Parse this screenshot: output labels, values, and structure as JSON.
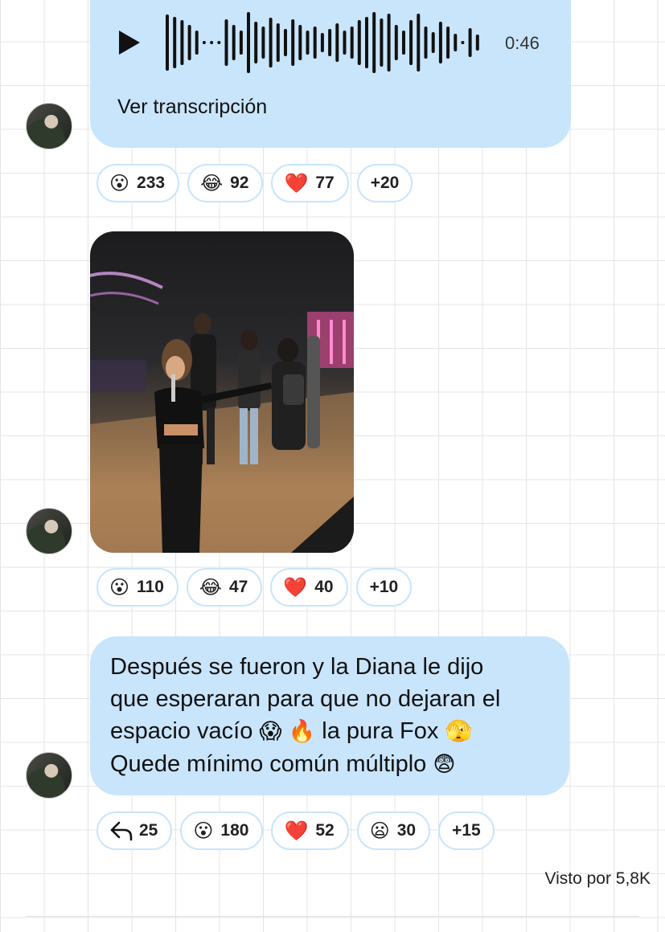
{
  "audio_message": {
    "play_icon": "play-icon",
    "duration": "0:46",
    "transcript_link": "Ver transcripción"
  },
  "audio_reactions": [
    {
      "emoji": "😮",
      "count": "233"
    },
    {
      "emoji": "😂",
      "count": "92"
    },
    {
      "emoji": "❤️",
      "count": "77"
    }
  ],
  "audio_reactions_more": "+20",
  "photo_message": {
    "description_icon": "video-thumbnail"
  },
  "photo_reactions": [
    {
      "emoji": "😮",
      "count": "110"
    },
    {
      "emoji": "😂",
      "count": "47"
    },
    {
      "emoji": "❤️",
      "count": "40"
    }
  ],
  "photo_reactions_more": "+10",
  "text_message": {
    "line1": "Después se fueron y la Diana le dijo",
    "line2": "que esperaran para que no dejaran el",
    "line3_a": "espacio vacío",
    "line3_emoji1": "😱",
    "line3_emoji2": "🔥",
    "line3_b": "la pura Fox",
    "line3_emoji3": "🫣",
    "line4": "Quede mínimo común múltiplo",
    "line4_emoji": "😨"
  },
  "text_reactions": {
    "replies": {
      "icon": "reply-arrow-icon",
      "count": "25"
    },
    "items": [
      {
        "emoji": "😮",
        "count": "180"
      },
      {
        "emoji": "❤️",
        "count": "52"
      },
      {
        "emoji": "😦",
        "count": "30"
      }
    ],
    "more": "+15"
  },
  "seen_by": "Visto por 5,8K",
  "colors": {
    "bubble": "#c9e5fb",
    "background_grid": "#e4e4e4"
  }
}
